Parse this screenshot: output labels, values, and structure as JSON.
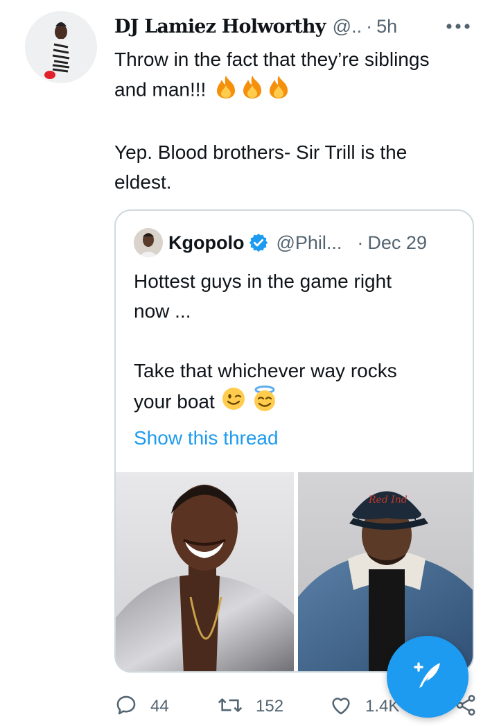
{
  "tweet": {
    "author_name": "DJ Lamiez Holworthy",
    "author_handle": "@..",
    "separator": "·",
    "time": "5h",
    "text_line1": "Throw in the fact that they’re siblings",
    "text_line2": "and man!!!",
    "text_para2_line1": "Yep. Blood brothers- Sir Trill is the",
    "text_para2_line2": "eldest.",
    "emoji": [
      "fire-emoji",
      "fire-emoji",
      "fire-emoji"
    ]
  },
  "quote": {
    "author_name": "Kgopolo",
    "author_handle": "@Phil...",
    "separator": "·",
    "time": "Dec 29",
    "text_line1": "Hottest guys in the game right",
    "text_line2": "now ...",
    "text_para2_line1": "Take that whichever way rocks",
    "text_para2_line2": "your boat",
    "emoji": [
      "winking-face-emoji",
      "smiling-face-with-halo-emoji"
    ],
    "show_thread": "Show this thread",
    "images": [
      "portrait-photo-man-smiling",
      "portrait-photo-man-cap-denim-jacket"
    ]
  },
  "actions": {
    "reply_count": "44",
    "retweet_count": "152",
    "like_count": "1.4K"
  },
  "icons": {
    "more": "more-icon",
    "verified": "verified-badge-icon",
    "reply": "reply-icon",
    "retweet": "retweet-icon",
    "like": "like-icon",
    "share": "share-icon",
    "compose": "compose-tweet-icon"
  },
  "colors": {
    "accent": "#1d9bf0",
    "text": "#0f1419",
    "secondary": "#536471",
    "border": "#cfd9de"
  }
}
